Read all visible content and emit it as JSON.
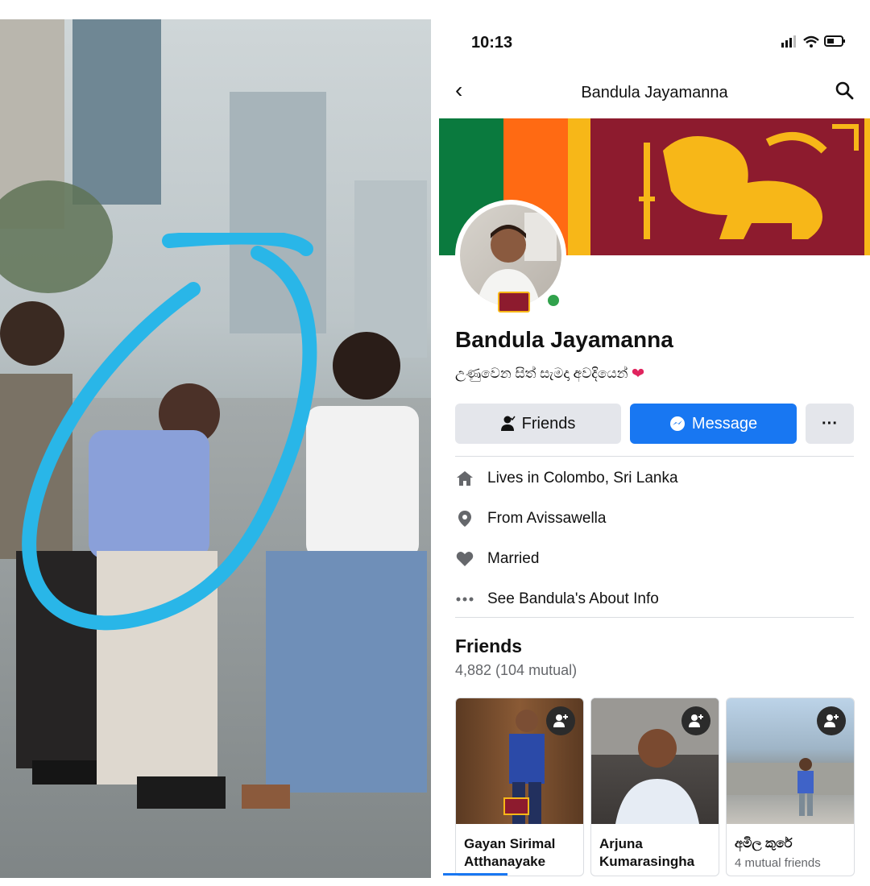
{
  "status": {
    "time": "10:13",
    "icons": "signal-wifi-battery"
  },
  "nav": {
    "title": "Bandula Jayamanna"
  },
  "profile": {
    "name": "Bandula Jayamanna",
    "bio": "උණුවෙන සිත් සැමදා අවදියෙන්",
    "bio_emoji": "❤"
  },
  "buttons": {
    "friends": "Friends",
    "message": "Message",
    "more": "···"
  },
  "info": [
    {
      "icon": "home-icon",
      "label": "Lives in Colombo, Sri Lanka"
    },
    {
      "icon": "location-pin-icon",
      "label": "From Avissawella"
    },
    {
      "icon": "heart-icon",
      "label": "Married"
    },
    {
      "icon": "more-dots-icon",
      "label": "See Bandula's About Info"
    }
  ],
  "friends": {
    "title": "Friends",
    "count": "4,882 (104 mutual)",
    "cards": [
      {
        "name": "Gayan Sirimal Atthanayake",
        "sub": ""
      },
      {
        "name": "Arjuna Kumarasingha",
        "sub": ""
      },
      {
        "name": "අමිල කුරේ",
        "sub": "4 mutual friends"
      }
    ]
  },
  "colors": {
    "accent": "#1877f2",
    "highlight": "#29b6e8",
    "flag_maroon": "#8d1b2e",
    "flag_gold": "#f7b718"
  }
}
